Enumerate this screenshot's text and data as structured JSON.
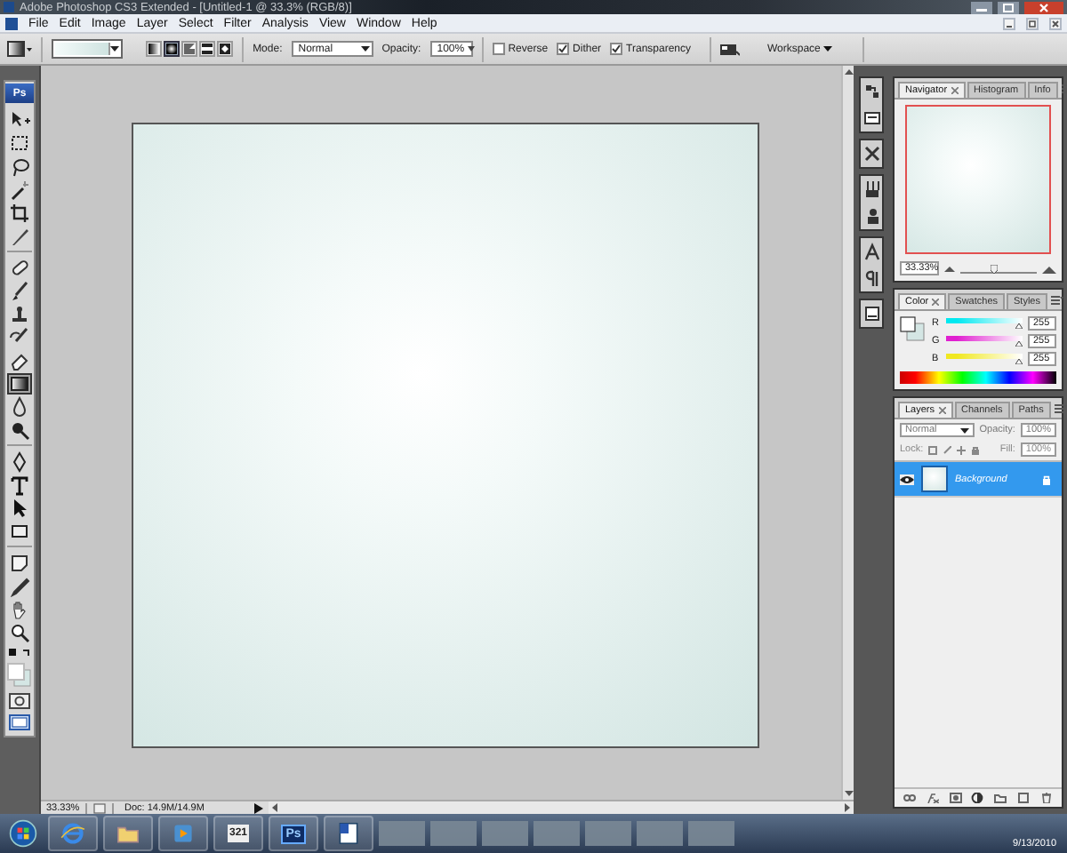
{
  "window": {
    "title": "Adobe Photoshop CS3 Extended - [Untitled-1 @ 33.3% (RGB/8)]"
  },
  "menu": [
    "File",
    "Edit",
    "Image",
    "Layer",
    "Select",
    "Filter",
    "Analysis",
    "View",
    "Window",
    "Help"
  ],
  "options_bar": {
    "gradient_types": [
      {
        "kind": "linear",
        "selected": false
      },
      {
        "kind": "radial",
        "selected": true
      },
      {
        "kind": "angle",
        "selected": false
      },
      {
        "kind": "reflected",
        "selected": false
      },
      {
        "kind": "diamond",
        "selected": false
      }
    ],
    "mode_label": "Mode:",
    "mode": "Normal",
    "opacity_label": "Opacity:",
    "opacity": "100%",
    "checkboxes": [
      {
        "label": "Reverse",
        "checked": false
      },
      {
        "label": "Dither",
        "checked": true
      },
      {
        "label": "Transparency",
        "checked": true
      }
    ],
    "workspace": "Workspace"
  },
  "toolbox": {
    "logo": "Ps",
    "groups": [
      [
        {
          "kind": "move",
          "selected": false
        },
        {
          "kind": "marquee",
          "selected": false
        },
        {
          "kind": "lasso",
          "selected": false
        },
        {
          "kind": "wand",
          "selected": false
        },
        {
          "kind": "crop",
          "selected": false
        },
        {
          "kind": "slice",
          "selected": false
        }
      ],
      [
        {
          "kind": "heal",
          "selected": false
        },
        {
          "kind": "brush",
          "selected": false
        },
        {
          "kind": "stamp",
          "selected": false
        },
        {
          "kind": "history",
          "selected": false
        },
        {
          "kind": "eraser",
          "selected": false
        },
        {
          "kind": "gradient",
          "selected": true
        },
        {
          "kind": "blur",
          "selected": false
        },
        {
          "kind": "dodge",
          "selected": false
        }
      ],
      [
        {
          "kind": "pen",
          "selected": false
        },
        {
          "kind": "type",
          "selected": false
        },
        {
          "kind": "pointer",
          "selected": false
        },
        {
          "kind": "shape",
          "selected": false
        }
      ],
      [
        {
          "kind": "notes",
          "selected": false
        },
        {
          "kind": "eyedropper",
          "selected": false
        },
        {
          "kind": "hand",
          "selected": false
        },
        {
          "kind": "zoom",
          "selected": false
        }
      ]
    ]
  },
  "document": {
    "zoom": "33.33%",
    "info": "Doc: 14.9M/14.9M"
  },
  "navigator": {
    "tabs": [
      {
        "label": "Navigator",
        "selected": true
      },
      {
        "label": "Histogram",
        "selected": false
      },
      {
        "label": "Info",
        "selected": false
      }
    ],
    "zoom": "33.33%",
    "level": 0.45
  },
  "color": {
    "tabs": [
      {
        "label": "Color",
        "selected": true
      },
      {
        "label": "Swatches",
        "selected": false
      },
      {
        "label": "Styles",
        "selected": false
      }
    ],
    "channels": [
      {
        "name": "R",
        "value": "255",
        "level": 1,
        "color": "#00e8f0"
      },
      {
        "name": "G",
        "value": "255",
        "level": 1,
        "color": "#e020d0"
      },
      {
        "name": "B",
        "value": "255",
        "level": 1,
        "color": "#f0e820"
      }
    ]
  },
  "layers": {
    "tabs": [
      {
        "label": "Layers",
        "selected": true
      },
      {
        "label": "Channels",
        "selected": false
      },
      {
        "label": "Paths",
        "selected": false
      }
    ],
    "blend_mode": "Normal",
    "opacity_label": "Opacity:",
    "opacity": "100%",
    "lock_label": "Lock:",
    "fill_label": "Fill:",
    "fill": "100%",
    "items": [
      {
        "name": "Background",
        "visible": true,
        "selected": true,
        "locked": true
      }
    ]
  },
  "taskbar": {
    "items": [
      {
        "kind": "start"
      },
      {
        "kind": "browser"
      },
      {
        "kind": "folder"
      },
      {
        "kind": "media"
      },
      {
        "kind": "calendar",
        "label": "321"
      },
      {
        "kind": "photoshop",
        "label": "Ps"
      },
      {
        "kind": "document"
      },
      {
        "kind": "thumbnail"
      },
      {
        "kind": "thumbnail"
      },
      {
        "kind": "thumbnail"
      },
      {
        "kind": "thumbnail"
      },
      {
        "kind": "thumbnail"
      },
      {
        "kind": "thumbnail"
      },
      {
        "kind": "thumbnail"
      }
    ],
    "date": "9/13/2010"
  }
}
